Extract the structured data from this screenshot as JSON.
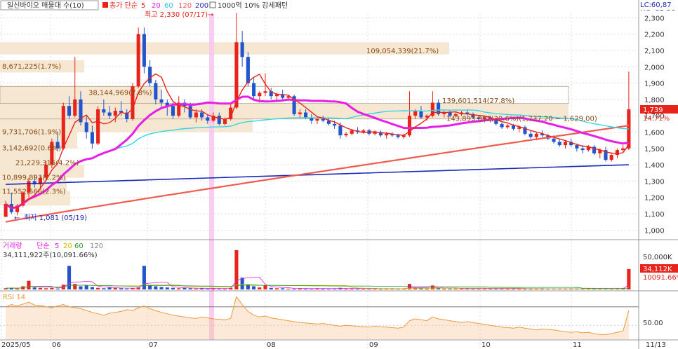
{
  "header": {
    "title": "일신바이오 매물대 수(10)",
    "legend_prefix": "종가 단순",
    "ma_periods": [
      "5",
      "20",
      "60",
      "120",
      "200"
    ],
    "note": "1000억 10% 강세패턴",
    "lc": "LC:60,87",
    "hc": "HC:-25,36"
  },
  "annotations": {
    "high": "최고 2,330 (07/17)",
    "low": "최저 1,081 (05/19)"
  },
  "price_axis": {
    "ticks": [
      "2,300",
      "2,200",
      "2,100",
      "2,000",
      "1,900",
      "1,800",
      "1,700",
      "1,600",
      "1,500",
      "1,400",
      "1,300",
      "1,200",
      "1,100",
      "1,000"
    ],
    "current": "1,739",
    "current_change": "14.71%"
  },
  "volume_profile": {
    "labels": [
      "109,054,339(21.7%)",
      "8,671,225(1.7%)",
      "38,144,969(7.8%)",
      "139,601,514(27.8%)",
      "9,731,706(1.9%)",
      "3,142,692(0.6%)",
      "21,229,316(4.2%)",
      "10,899,893(2.2%)",
      "11,552,566(2.3%)",
      "143,893,082(30.6%)(1,737.20 ~ 1,629.00)"
    ]
  },
  "volume_panel": {
    "title": "거래량",
    "legend_prefix": "단순",
    "ma_periods": [
      "5",
      "20",
      "60",
      "120"
    ],
    "value_text": "34,111,922주(10,091.66%)",
    "axis_label": "50,000K",
    "current": "34,112K",
    "current_pct": "10091.66%"
  },
  "rsi_panel": {
    "title": "RSI 14",
    "axis_label": "50.00"
  },
  "x_axis": {
    "labels": [
      "2025/05",
      "06",
      "07",
      "08",
      "09",
      "10",
      "11",
      "11/13"
    ]
  },
  "colors": {
    "up": "#e8231c",
    "down": "#2255cc",
    "ma5": "#e8231c",
    "ma20": "#e61fe6",
    "ma60": "#33d6e6",
    "ma120": "#f05a4f",
    "ma200": "#1c2bb5",
    "profile": "#f6e7d3",
    "rsi": "#f09a40",
    "highlight": "#f8c6f0"
  },
  "chart_data": {
    "type": "candlestick",
    "price_ylim": [
      950,
      2340
    ],
    "ohlc_approx": [
      [
        1081,
        1180,
        1081,
        1160
      ],
      [
        1160,
        1230,
        1100,
        1110
      ],
      [
        1110,
        1160,
        1090,
        1150
      ],
      [
        1150,
        1240,
        1140,
        1230
      ],
      [
        1230,
        1320,
        1200,
        1300
      ],
      [
        1300,
        1340,
        1260,
        1280
      ],
      [
        1280,
        1330,
        1250,
        1320
      ],
      [
        1320,
        1420,
        1300,
        1400
      ],
      [
        1400,
        1560,
        1380,
        1540
      ],
      [
        1540,
        1600,
        1480,
        1500
      ],
      [
        1500,
        1780,
        1490,
        1760
      ],
      [
        1760,
        1820,
        1680,
        1700
      ],
      [
        1700,
        2060,
        1690,
        1800
      ],
      [
        1800,
        1850,
        1640,
        1660
      ],
      [
        1660,
        1700,
        1560,
        1600
      ],
      [
        1600,
        1640,
        1500,
        1530
      ],
      [
        1530,
        1760,
        1520,
        1740
      ],
      [
        1740,
        1800,
        1700,
        1720
      ],
      [
        1720,
        1760,
        1680,
        1700
      ],
      [
        1700,
        1750,
        1660,
        1730
      ],
      [
        1730,
        1790,
        1700,
        1720
      ],
      [
        1720,
        1740,
        1660,
        1680
      ],
      [
        1680,
        1900,
        1670,
        1880
      ],
      [
        1880,
        2240,
        1870,
        2200
      ],
      [
        2200,
        2240,
        1960,
        2000
      ],
      [
        2000,
        2040,
        1880,
        1900
      ],
      [
        1900,
        1920,
        1770,
        1800
      ],
      [
        1800,
        1860,
        1740,
        1780
      ],
      [
        1780,
        1800,
        1700,
        1760
      ],
      [
        1760,
        1780,
        1680,
        1700
      ],
      [
        1700,
        1820,
        1690,
        1780
      ],
      [
        1780,
        1800,
        1720,
        1760
      ],
      [
        1760,
        1780,
        1680,
        1690
      ],
      [
        1690,
        1740,
        1660,
        1720
      ],
      [
        1720,
        1740,
        1670,
        1690
      ],
      [
        1690,
        1710,
        1650,
        1670
      ],
      [
        1670,
        1720,
        1660,
        1700
      ],
      [
        1700,
        1720,
        1640,
        1650
      ],
      [
        1650,
        1690,
        1640,
        1680
      ],
      [
        1680,
        1780,
        1670,
        1750
      ],
      [
        1750,
        2330,
        1740,
        2150
      ],
      [
        2150,
        2220,
        2000,
        2060
      ],
      [
        2060,
        2090,
        1880,
        1900
      ],
      [
        1900,
        1930,
        1800,
        1820
      ],
      [
        1820,
        1850,
        1780,
        1840
      ],
      [
        1840,
        1960,
        1820,
        1850
      ],
      [
        1850,
        1870,
        1800,
        1820
      ],
      [
        1820,
        1840,
        1790,
        1830
      ],
      [
        1830,
        1860,
        1800,
        1810
      ],
      [
        1810,
        1830,
        1790,
        1820
      ],
      [
        1820,
        1830,
        1700,
        1710
      ],
      [
        1710,
        1740,
        1690,
        1720
      ],
      [
        1720,
        1740,
        1680,
        1690
      ],
      [
        1690,
        1710,
        1650,
        1670
      ],
      [
        1670,
        1690,
        1650,
        1680
      ],
      [
        1680,
        1700,
        1660,
        1670
      ],
      [
        1670,
        1690,
        1640,
        1650
      ],
      [
        1650,
        1670,
        1620,
        1640
      ],
      [
        1640,
        1660,
        1560,
        1580
      ],
      [
        1580,
        1600,
        1570,
        1590
      ],
      [
        1590,
        1620,
        1580,
        1610
      ],
      [
        1610,
        1630,
        1590,
        1600
      ],
      [
        1600,
        1620,
        1590,
        1610
      ],
      [
        1610,
        1620,
        1580,
        1590
      ],
      [
        1590,
        1610,
        1580,
        1600
      ],
      [
        1600,
        1610,
        1570,
        1580
      ],
      [
        1580,
        1600,
        1560,
        1590
      ],
      [
        1590,
        1600,
        1570,
        1580
      ],
      [
        1580,
        1590,
        1560,
        1570
      ],
      [
        1570,
        1590,
        1560,
        1580
      ],
      [
        1580,
        1850,
        1570,
        1700
      ],
      [
        1700,
        1740,
        1680,
        1730
      ],
      [
        1730,
        1760,
        1680,
        1690
      ],
      [
        1690,
        1710,
        1670,
        1700
      ],
      [
        1700,
        1850,
        1690,
        1780
      ],
      [
        1780,
        1800,
        1700,
        1710
      ],
      [
        1710,
        1730,
        1690,
        1720
      ],
      [
        1720,
        1730,
        1690,
        1700
      ],
      [
        1700,
        1720,
        1690,
        1710
      ],
      [
        1710,
        1730,
        1700,
        1720
      ],
      [
        1720,
        1740,
        1700,
        1710
      ],
      [
        1710,
        1720,
        1680,
        1690
      ],
      [
        1690,
        1700,
        1670,
        1680
      ],
      [
        1680,
        1700,
        1660,
        1690
      ],
      [
        1690,
        1700,
        1660,
        1670
      ],
      [
        1670,
        1680,
        1640,
        1650
      ],
      [
        1650,
        1660,
        1620,
        1630
      ],
      [
        1630,
        1650,
        1620,
        1640
      ],
      [
        1640,
        1650,
        1610,
        1620
      ],
      [
        1620,
        1640,
        1600,
        1630
      ],
      [
        1630,
        1640,
        1580,
        1590
      ],
      [
        1590,
        1610,
        1560,
        1570
      ],
      [
        1570,
        1600,
        1550,
        1590
      ],
      [
        1590,
        1610,
        1570,
        1580
      ],
      [
        1580,
        1590,
        1550,
        1560
      ],
      [
        1560,
        1580,
        1530,
        1540
      ],
      [
        1540,
        1560,
        1510,
        1520
      ],
      [
        1520,
        1550,
        1500,
        1540
      ],
      [
        1540,
        1560,
        1510,
        1520
      ],
      [
        1520,
        1530,
        1480,
        1500
      ],
      [
        1500,
        1520,
        1470,
        1490
      ],
      [
        1490,
        1520,
        1480,
        1510
      ],
      [
        1510,
        1520,
        1460,
        1470
      ],
      [
        1470,
        1500,
        1440,
        1490
      ],
      [
        1490,
        1510,
        1420,
        1430
      ],
      [
        1430,
        1470,
        1420,
        1460
      ],
      [
        1460,
        1500,
        1440,
        1490
      ],
      [
        1490,
        1520,
        1480,
        1500
      ],
      [
        1500,
        1970,
        1490,
        1739
      ]
    ],
    "volume_pct_of_max": [
      3,
      4,
      2,
      8,
      22,
      5,
      4,
      3,
      4,
      2,
      12,
      60,
      14,
      8,
      10,
      6,
      4,
      3,
      5,
      4,
      3,
      2,
      3,
      5,
      60,
      10,
      8,
      6,
      5,
      4,
      3,
      4,
      3,
      2,
      3,
      2,
      3,
      2,
      2,
      4,
      100,
      30,
      12,
      8,
      5,
      10,
      4,
      3,
      3,
      2,
      2,
      3,
      2,
      2,
      3,
      2,
      2,
      2,
      4,
      2,
      2,
      2,
      2,
      2,
      2,
      2,
      2,
      2,
      2,
      2,
      14,
      4,
      3,
      2,
      10,
      3,
      2,
      2,
      2,
      2,
      2,
      2,
      2,
      2,
      2,
      2,
      2,
      2,
      2,
      2,
      2,
      2,
      2,
      2,
      2,
      2,
      2,
      2,
      2,
      2,
      2,
      2,
      2,
      3,
      2,
      2,
      2,
      2,
      52
    ],
    "rsi_approx": [
      70,
      75,
      72,
      76,
      80,
      74,
      73,
      70,
      68,
      72,
      75,
      70,
      68,
      66,
      62,
      58,
      55,
      52,
      56,
      58,
      60,
      64,
      62,
      68,
      72,
      66,
      62,
      58,
      55,
      52,
      50,
      48,
      46,
      45,
      48,
      46,
      44,
      43,
      42,
      45,
      92,
      75,
      60,
      52,
      48,
      50,
      46,
      44,
      42,
      40,
      38,
      36,
      35,
      34,
      33,
      34,
      32,
      30,
      28,
      30,
      29,
      28,
      27,
      26,
      28,
      27,
      26,
      25,
      24,
      26,
      40,
      44,
      42,
      40,
      48,
      44,
      42,
      40,
      38,
      36,
      38,
      36,
      34,
      32,
      30,
      28,
      26,
      25,
      24,
      26,
      24,
      22,
      20,
      22,
      21,
      20,
      18,
      16,
      15,
      16,
      14,
      15,
      12,
      10,
      10,
      12,
      15,
      18,
      62
    ],
    "ma_end_values": {
      "ma5": 1519,
      "ma20": 1510,
      "ma60": 1600,
      "ma120": 1640,
      "ma200": 1400
    }
  }
}
